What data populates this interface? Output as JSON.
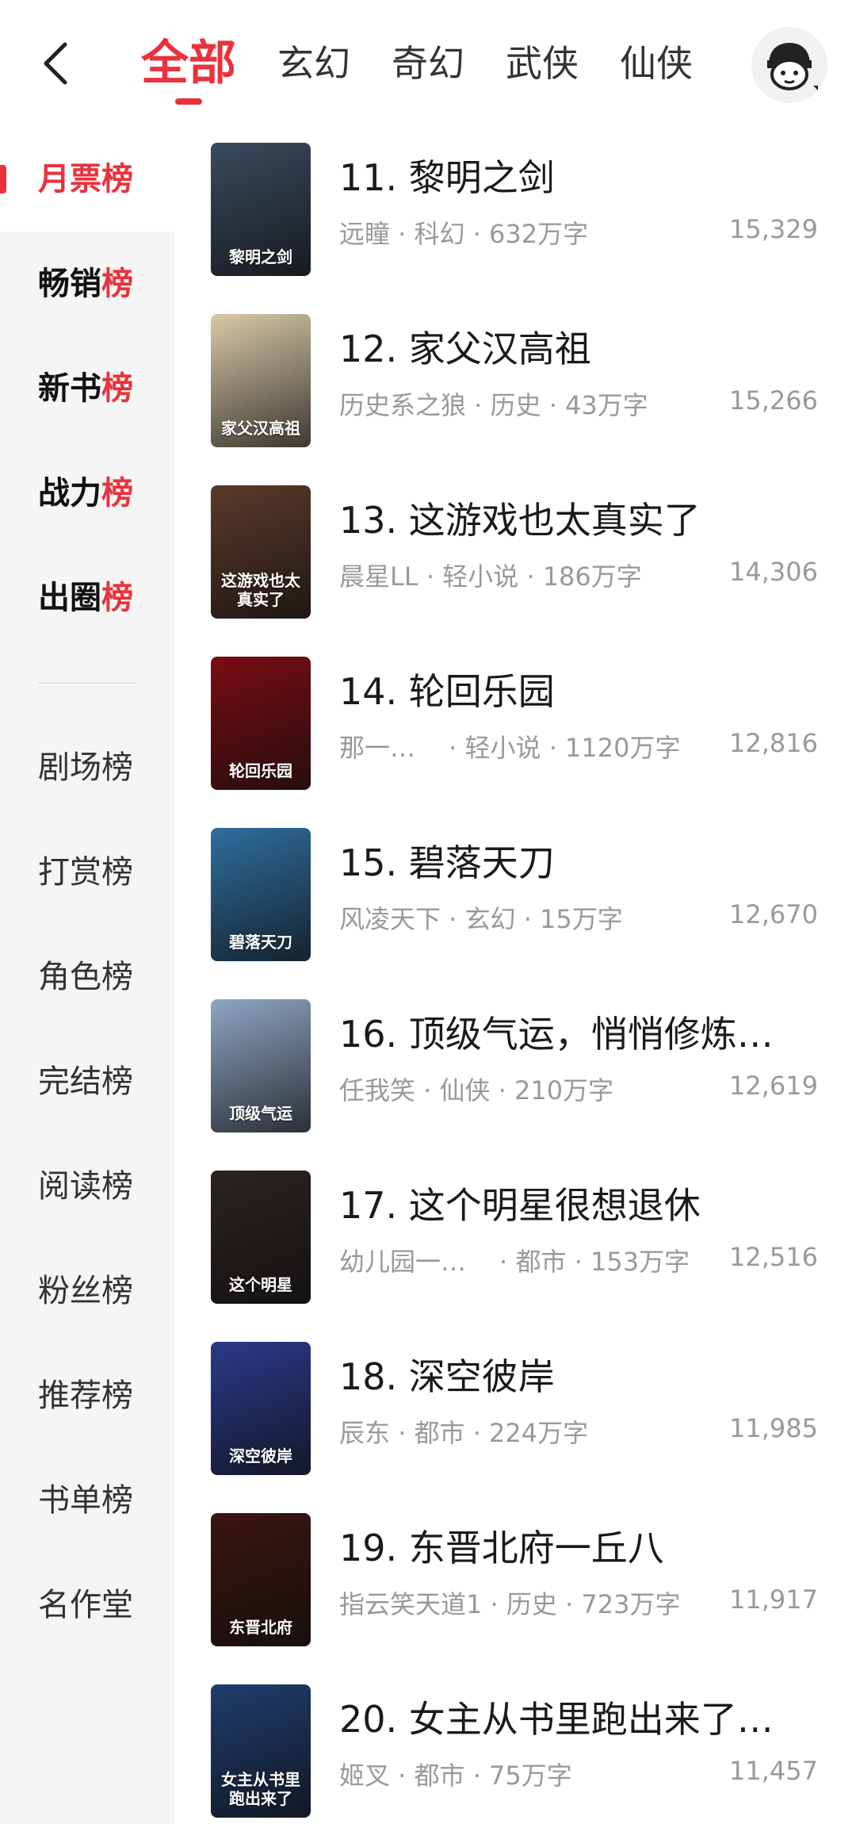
{
  "header": {
    "tabs": [
      "全部",
      "玄幻",
      "奇幻",
      "武侠",
      "仙侠"
    ],
    "active_tab": 0
  },
  "sidebar": {
    "primary": [
      {
        "label_head": "月票",
        "label_tail": "榜"
      },
      {
        "label_head": "畅销",
        "label_tail": "榜"
      },
      {
        "label_head": "新书",
        "label_tail": "榜"
      },
      {
        "label_head": "战力",
        "label_tail": "榜"
      },
      {
        "label_head": "出圈",
        "label_tail": "榜"
      }
    ],
    "secondary": [
      "剧场榜",
      "打赏榜",
      "角色榜",
      "完结榜",
      "阅读榜",
      "粉丝榜",
      "推荐榜",
      "书单榜",
      "名作堂"
    ]
  },
  "books": [
    {
      "title": "11. 黎明之剑",
      "meta": "远瞳 · 科幻 · 632万字",
      "votes": "15,329",
      "cover_text": "黎明之剑",
      "cover_color": "#3a4a5e"
    },
    {
      "title": "12. 家父汉高祖",
      "meta": "历史系之狼 · 历史 · 43万字",
      "votes": "15,266",
      "cover_text": "家父汉高祖",
      "cover_color": "#d9c9a8"
    },
    {
      "title": "13. 这游戏也太真实了",
      "meta": "晨星LL · 轻小说 · 186万字",
      "votes": "14,306",
      "cover_text": "这游戏也太真实了",
      "cover_color": "#5b3a2a"
    },
    {
      "title": "14. 轮回乐园",
      "meta": "那一…　 · 轻小说 · 1120万字",
      "votes": "12,816",
      "cover_text": "轮回乐园",
      "cover_color": "#7a0d12"
    },
    {
      "title": "15. 碧落天刀",
      "meta": "风凌天下 · 玄幻 · 15万字",
      "votes": "12,670",
      "cover_text": "碧落天刀",
      "cover_color": "#2f6e9e"
    },
    {
      "title": "16. 顶级气运，悄悄修炼…",
      "meta": "任我笑 · 仙侠 · 210万字",
      "votes": "12,619",
      "cover_text": "顶级气运",
      "cover_color": "#8fa6c4"
    },
    {
      "title": "17. 这个明星很想退休",
      "meta": "幼儿园一…　 · 都市 · 153万字",
      "votes": "12,516",
      "cover_text": "这个明星",
      "cover_color": "#2b2320"
    },
    {
      "title": "18. 深空彼岸",
      "meta": "辰东 · 都市 · 224万字",
      "votes": "11,985",
      "cover_text": "深空彼岸",
      "cover_color": "#2a3a8a"
    },
    {
      "title": "19. 东晋北府一丘八",
      "meta": "指云笑天道1 · 历史 · 723万字",
      "votes": "11,917",
      "cover_text": "东晋北府",
      "cover_color": "#3a1510"
    },
    {
      "title": "20. 女主从书里跑出来了…",
      "meta": "姬叉 · 都市 · 75万字",
      "votes": "11,457",
      "cover_text": "女主从书里跑出来了",
      "cover_color": "#1f3d6e"
    }
  ],
  "colors": {
    "accent": "#e8333d",
    "text_primary": "#1a1a1a",
    "text_secondary": "#999999",
    "sidebar_bg": "#f5f5f5"
  },
  "icons": {
    "back": "chevron-left-icon",
    "avatar": "user-avatar-icon"
  }
}
